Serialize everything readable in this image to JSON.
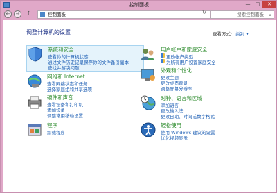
{
  "window": {
    "title": "控制面板",
    "minimize": "—",
    "maximize": "□",
    "close": "✕"
  },
  "nav": {
    "back": "←",
    "forward": "→",
    "up": "↑",
    "address": "控制面板",
    "refresh": "↻",
    "search_placeholder": "搜索控制面板"
  },
  "main": {
    "heading": "调整计算机的设置",
    "viewby_label": "查看方式:",
    "viewby_value": "类别 ▾"
  },
  "categories": [
    {
      "title": "系统和安全",
      "links": [
        "查看你的计算机状态",
        "通过文件历史记录保存你的文件备份副本",
        "查找并解决问题"
      ],
      "icon": "shield-icon"
    },
    {
      "title": "用户帐户和家庭安全",
      "links": [
        "更改帐户类型",
        "为所有用户设置家庭安全"
      ],
      "icon": "users-icon"
    },
    {
      "title": "网络和 Internet",
      "links": [
        "查看网络状态和任务",
        "选择家庭组和共享选项"
      ],
      "icon": "network-icon"
    },
    {
      "title": "外观和个性化",
      "links": [
        "更改主题",
        "更改桌面背景",
        "调整屏幕分辨率"
      ],
      "icon": "appearance-icon"
    },
    {
      "title": "硬件和声音",
      "links": [
        "查看设备和打印机",
        "添加设备",
        "调整常用移动设置"
      ],
      "icon": "printer-icon"
    },
    {
      "title": "时钟、语言和区域",
      "links": [
        "添加语言",
        "更改输入法",
        "更改日期、时间或数字格式"
      ],
      "icon": "clock-globe-icon"
    },
    {
      "title": "程序",
      "links": [
        "卸载程序"
      ],
      "icon": "programs-icon"
    },
    {
      "title": "轻松使用",
      "links": [
        "使用 Windows 建议的设置",
        "优化视频显示"
      ],
      "icon": "ease-of-access-icon"
    }
  ]
}
